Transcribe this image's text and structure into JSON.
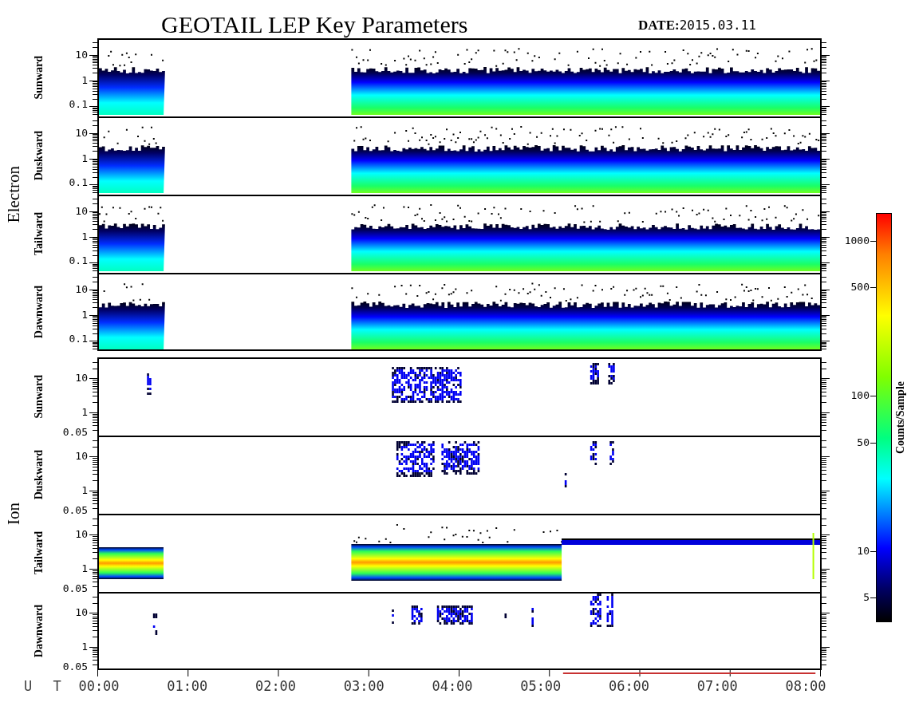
{
  "title": "GEOTAIL LEP Key Parameters",
  "date_label": "DATE:",
  "date": "2015.03.11",
  "groups": [
    {
      "label": "Electron",
      "panels": [
        {
          "label": "Sunward",
          "kind": "electron_band",
          "yticks": [
            "10",
            "1",
            "0.1"
          ]
        },
        {
          "label": "Duskward",
          "kind": "electron_band",
          "yticks": [
            "10",
            "1",
            "0.1"
          ]
        },
        {
          "label": "Tailward",
          "kind": "electron_band",
          "yticks": [
            "10",
            "1",
            "0.1"
          ]
        },
        {
          "label": "Dawnward",
          "kind": "electron_band",
          "yticks": [
            "10",
            "1",
            "0.1"
          ]
        }
      ]
    },
    {
      "label": "Ion",
      "panels": [
        {
          "label": "Sunward",
          "kind": "ion_patches",
          "yticks": [
            "10",
            "1",
            "0.05"
          ]
        },
        {
          "label": "Duskward",
          "kind": "ion_patches",
          "yticks": [
            "10",
            "1",
            "0.05"
          ]
        },
        {
          "label": "Tailward",
          "kind": "ion_band",
          "yticks": [
            "10",
            "1",
            "0.05"
          ]
        },
        {
          "label": "Dawnward",
          "kind": "ion_patches",
          "yticks": [
            "10",
            "1",
            "0.05"
          ]
        }
      ]
    }
  ],
  "x_axis": {
    "label": "U T",
    "ticks": [
      "00:00",
      "01:00",
      "02:00",
      "03:00",
      "04:00",
      "05:00",
      "06:00",
      "07:00",
      "08:00"
    ]
  },
  "colorbar": {
    "label": "Counts/Sample",
    "ticks": [
      "1000",
      "500",
      "100",
      "50",
      "10",
      "5"
    ]
  }
}
